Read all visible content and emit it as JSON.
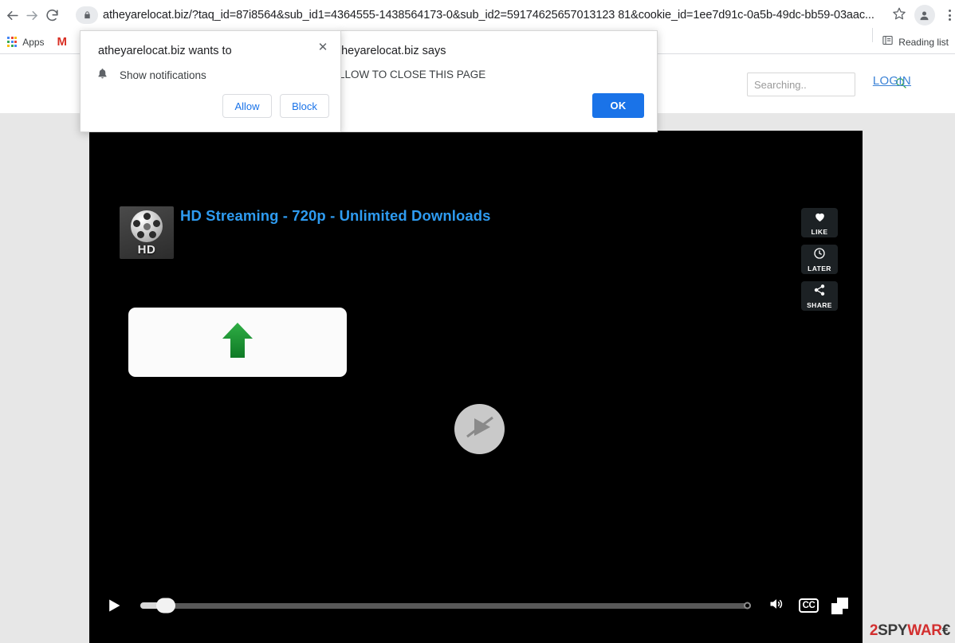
{
  "browser": {
    "back_icon": "back-arrow-icon",
    "forward_icon": "forward-arrow-icon",
    "reload_icon": "reload-icon",
    "lock_icon": "lock-icon",
    "url": "atheyarelocat.biz/?taq_id=87i8564&sub_id1=4364555-1438564173-0&sub_id2=59174625657013123 81&cookie_id=1ee7d91c-0a5b-49dc-bb59-03aac...",
    "bookmark_star_icon": "star-icon",
    "profile_icon": "profile-avatar-icon",
    "menu_icon": "three-dot-menu-icon",
    "bookmarks": {
      "apps_icon": "apps-grid-icon",
      "apps_label": "Apps",
      "gmail_label": "M",
      "reading_list_icon": "reading-list-icon",
      "reading_list_label": "Reading list"
    }
  },
  "notification_popup": {
    "title": "atheyarelocat.biz wants to",
    "bell_icon": "bell-icon",
    "permission_label": "Show notifications",
    "close_icon": "close-icon",
    "close_glyph": "✕",
    "allow_label": "Allow",
    "block_label": "Block"
  },
  "js_dialog": {
    "origin": "atheyarelocat.biz says",
    "message": "ALLOW TO CLOSE THIS PAGE",
    "ok_label": "OK"
  },
  "site": {
    "search": {
      "placeholder": "Searching..",
      "value": "",
      "icon": "search-icon"
    },
    "login_label": "LOGIN"
  },
  "video": {
    "logo_text": "HD",
    "logo_icon": "film-reel-icon",
    "title": "HD Streaming - 720p - Unlimited Downloads",
    "actions": [
      {
        "label": "LIKE",
        "icon": "heart-icon"
      },
      {
        "label": "LATER",
        "icon": "clock-icon"
      },
      {
        "label": "SHARE",
        "icon": "share-icon"
      }
    ],
    "overlay_card": {
      "icon": "green-up-arrow-icon"
    },
    "center_play": {
      "icon": "play-blocked-icon"
    },
    "controls": {
      "play_icon": "play-icon",
      "progress_percent": 4,
      "volume_icon": "volume-icon",
      "cc_label": "CC",
      "fullscreen_icon": "fullscreen-icon"
    }
  },
  "watermark": {
    "part1": "2",
    "part2": "SPY",
    "part3": "WAR",
    "part4": "€"
  },
  "colors": {
    "accent_blue": "#1a73e8",
    "title_blue": "#2e9bf0",
    "link_blue": "#3b82d6",
    "search_green": "#35a84c",
    "arrow_green": "#1e9233",
    "watermark_red": "#d32f2f",
    "page_bg": "#e7e7e7",
    "video_bg": "#000000"
  }
}
